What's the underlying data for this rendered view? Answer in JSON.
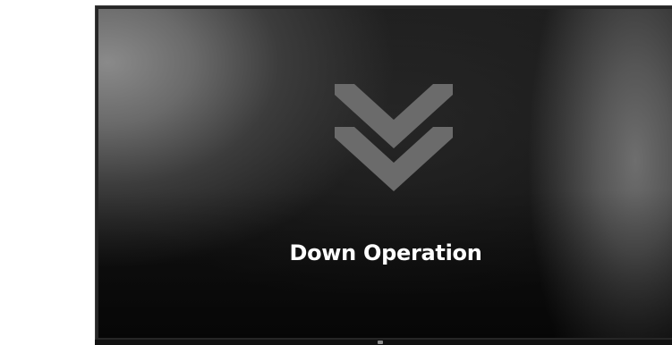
{
  "screen": {
    "operation_label": "Down Operation",
    "icon": "double-chevron-down-icon",
    "icon_color": "#6b6b6b",
    "text_color": "#ffffff"
  }
}
